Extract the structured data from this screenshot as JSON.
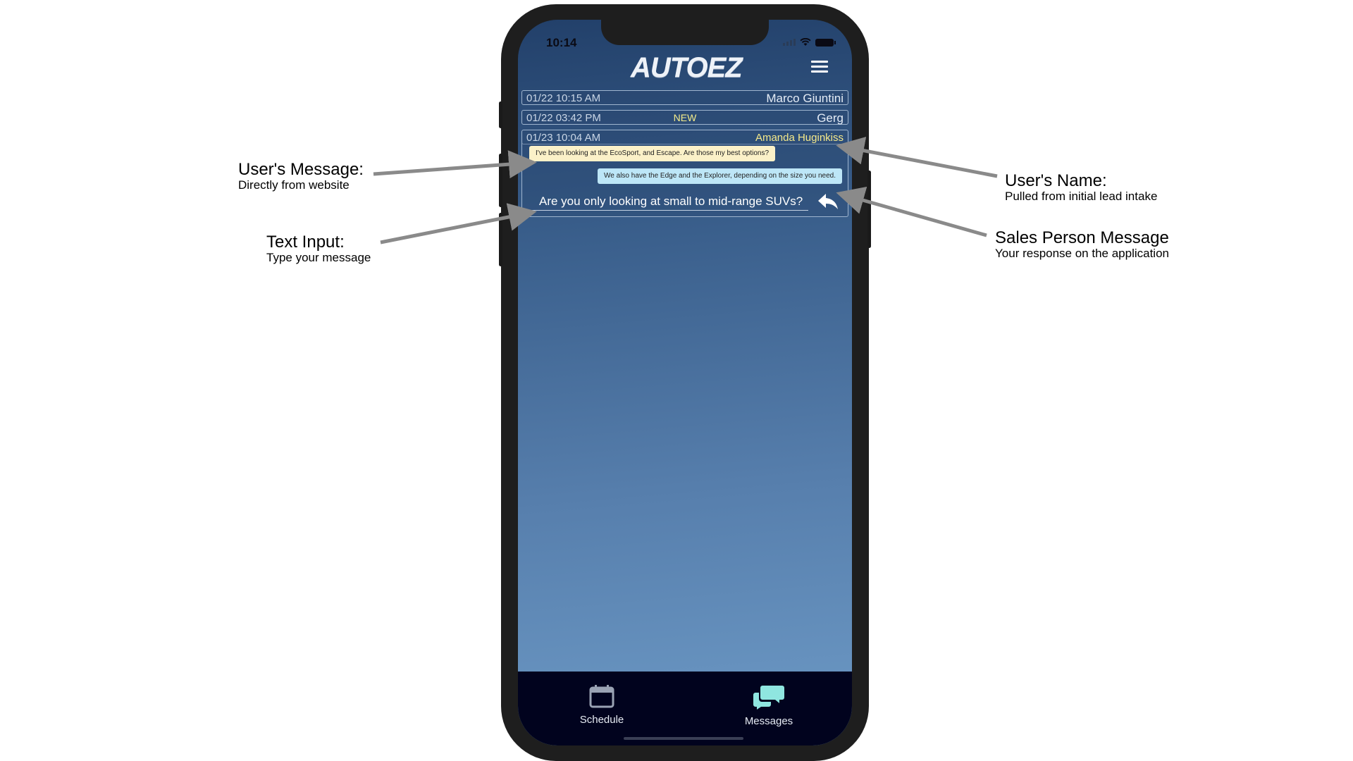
{
  "status_bar": {
    "time": "10:14"
  },
  "app": {
    "logo": "AUTOEZ"
  },
  "conversations": [
    {
      "date": "01/22 10:15 AM",
      "badge": "",
      "name": "Marco Giuntini"
    },
    {
      "date": "01/22 03:42 PM",
      "badge": "NEW",
      "name": "Gerg"
    },
    {
      "date": "01/23 10:04 AM",
      "badge": "",
      "name": "Amanda Huginkiss"
    }
  ],
  "thread": {
    "user_message": "I've been looking at the EcoSport, and Escape. Are those my best options?",
    "sales_message": "We also have the Edge and the Explorer, depending on the size you need.",
    "input_value": "Are you only looking at small to mid-range SUVs?"
  },
  "tabs": {
    "schedule": "Schedule",
    "messages": "Messages"
  },
  "annotations": {
    "user_message": {
      "title": "User's Message:",
      "subtitle": "Directly from website"
    },
    "text_input": {
      "title": "Text Input:",
      "subtitle": "Type your message"
    },
    "user_name": {
      "title": "User's Name:",
      "subtitle": "Pulled from initial lead intake"
    },
    "sales_message": {
      "title": "Sales Person Message",
      "subtitle": "Your response on the application"
    }
  },
  "colors": {
    "tab_active": "#8fe6e0",
    "tab_inactive": "#9aa3b4",
    "new_badge": "#f4ec8a",
    "user_bubble": "#fbf1c8",
    "sales_bubble": "#bde6f7"
  },
  "icons": {
    "menu": "hamburger-icon",
    "reply": "reply-arrow-icon",
    "schedule": "calendar-icon",
    "messages": "chat-bubbles-icon"
  }
}
